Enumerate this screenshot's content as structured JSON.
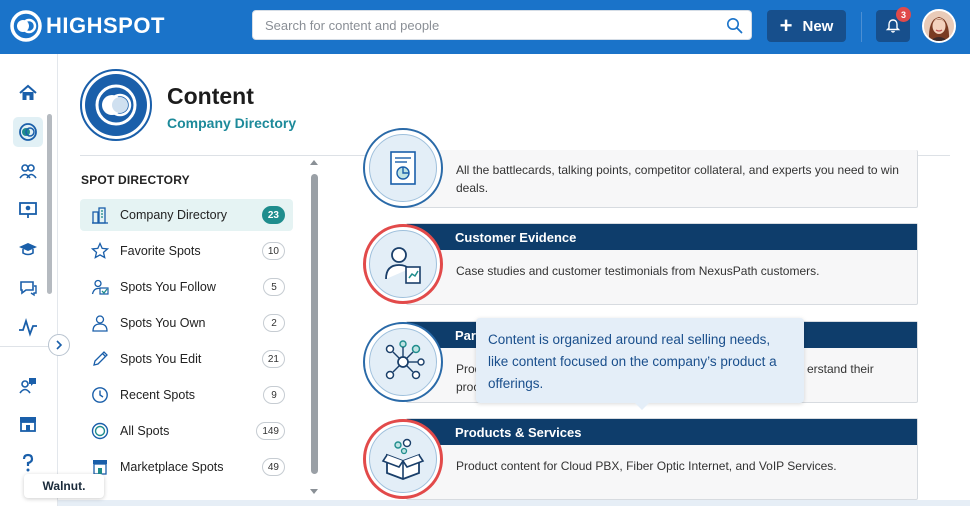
{
  "header": {
    "logo_text": "HIGHSPOT",
    "search_placeholder": "Search for content and people",
    "new_label": "New",
    "notification_count": "3"
  },
  "rail": {
    "items": [
      "home-icon",
      "spots-icon",
      "people-icon",
      "presentation-icon",
      "training-icon",
      "chat-icon",
      "analytics-icon",
      "feedback-icon",
      "store-icon",
      "help-icon"
    ]
  },
  "page": {
    "title": "Content",
    "subtitle": "Company Directory"
  },
  "directory": {
    "heading": "SPOT DIRECTORY",
    "items": [
      {
        "label": "Company Directory",
        "count": "23",
        "active": true
      },
      {
        "label": "Favorite Spots",
        "count": "10"
      },
      {
        "label": "Spots You Follow",
        "count": "5"
      },
      {
        "label": "Spots You Own",
        "count": "2"
      },
      {
        "label": "Spots You Edit",
        "count": "21"
      },
      {
        "label": "Recent Spots",
        "count": "9"
      },
      {
        "label": "All Spots",
        "count": "149"
      },
      {
        "label": "Marketplace Spots",
        "count": "49"
      }
    ]
  },
  "cards": [
    {
      "title": "",
      "desc": "All the battlecards, talking points, competitor collateral, and experts you need to win deals."
    },
    {
      "title": "Customer Evidence",
      "desc": "Case studies and customer testimonials from NexusPath customers."
    },
    {
      "title": "Part",
      "desc_left": "Prod",
      "desc_left2": "proc",
      "desc_right": "erstand their"
    },
    {
      "title": "Products & Services",
      "desc": "Product content for Cloud PBX, Fiber Optic Internet, and VoIP Services."
    }
  ],
  "tooltip": {
    "text": "Content is organized around real selling needs, like content focused on the company’s product a offerings."
  },
  "walnut": {
    "label": "Walnut."
  },
  "colors": {
    "brand_blue": "#1a73c9",
    "card_header": "#0e3d6b",
    "accent_teal": "#1f8d8d",
    "highlight_red": "#e24a4a"
  }
}
